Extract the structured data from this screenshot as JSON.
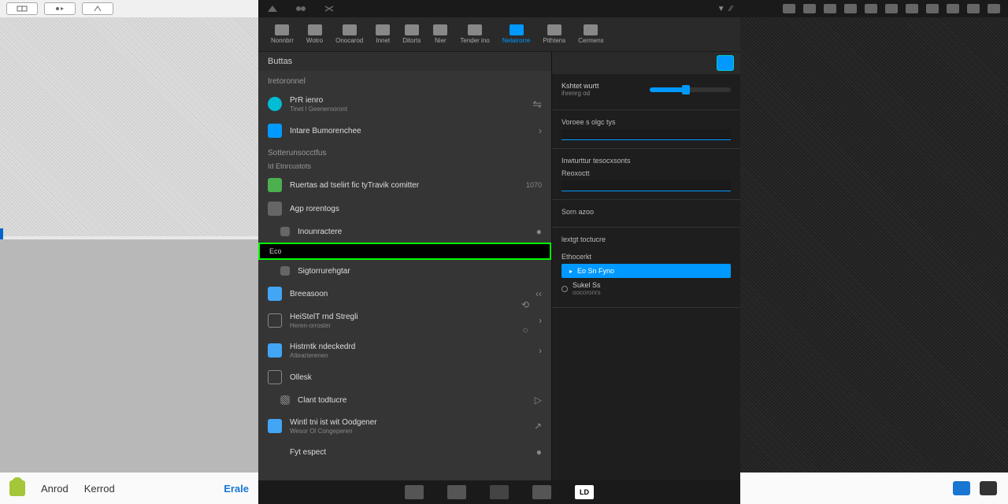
{
  "left_bottom": {
    "label1": "Anrod",
    "label2": "Kerrod",
    "label3": "Erale"
  },
  "tabs": [
    {
      "label": "Nonnbrr",
      "active": false
    },
    {
      "label": "Wotro",
      "active": false
    },
    {
      "label": "Onocarod",
      "active": false
    },
    {
      "label": "Innet",
      "active": false
    },
    {
      "label": "Ditorts",
      "active": false
    },
    {
      "label": "Nier",
      "active": false
    },
    {
      "label": "Tender ino",
      "active": false
    },
    {
      "label": "Netairorre",
      "active": true
    },
    {
      "label": "Pithtens",
      "active": false
    },
    {
      "label": "Cermens",
      "active": false
    }
  ],
  "list": {
    "header": "Buttas",
    "section1": "Iretoronnel",
    "items1": [
      {
        "title": "PrR ienro",
        "sub": "Tinet l Geenerooront",
        "icon": "teal",
        "right_icon": "wifi"
      },
      {
        "title": "Intare Bumorenchee",
        "icon": "blue",
        "right": "›"
      }
    ],
    "section2": "Sotterunsocctfus",
    "sub_section2": "Id Etnrcustots",
    "items2": [
      {
        "title": "Ruertas ad tselirt fic tyTravik comitter",
        "icon": "green",
        "right": "1070"
      },
      {
        "title": "Agp rorentogs",
        "icon": "gray"
      },
      {
        "title": "Inounractere",
        "icon": "gray",
        "right": "●"
      }
    ],
    "highlight": "Eco",
    "items3": [
      {
        "title": "Sigtorrurehgtar",
        "icon": "gray"
      },
      {
        "title": "Breeasoon",
        "icon": "lightblue",
        "right": "‹‹"
      },
      {
        "title": "HeiStelT rnd Stregli",
        "sub": "Heren-orroster",
        "icon": "outline",
        "right": "›"
      },
      {
        "title": "Histrntk ndeckedrd",
        "sub": "Attearterenen",
        "icon": "lightblue",
        "right": "›"
      },
      {
        "title": "Ollesk",
        "icon": "outline"
      },
      {
        "title": "Clant todtucre",
        "icon": "gray",
        "right": "▷",
        "indent": true
      },
      {
        "title": "Wintl tni ist wit Oodgener",
        "sub": "Wesor Ol Congeperen",
        "icon": "lightblue",
        "right": "↗"
      },
      {
        "title": "Fyt espect",
        "right": "●"
      }
    ]
  },
  "detail": {
    "row1_label": "Kshtet wurtt",
    "row1_sub": "ihrenrg od",
    "row2_label": "Voroee s olgc tys",
    "section2_title": "Inwturttur tesocxsonts",
    "section2_field": "Reoxoctt",
    "section3_title": "Sorn azoo",
    "section4_label": "lextgt toctucre",
    "section5_title": "Ethocerkt",
    "button_label": "Eo Sn Fyno",
    "radio_label": "Sukel Ss",
    "radio_sub": "oocoronrs"
  }
}
